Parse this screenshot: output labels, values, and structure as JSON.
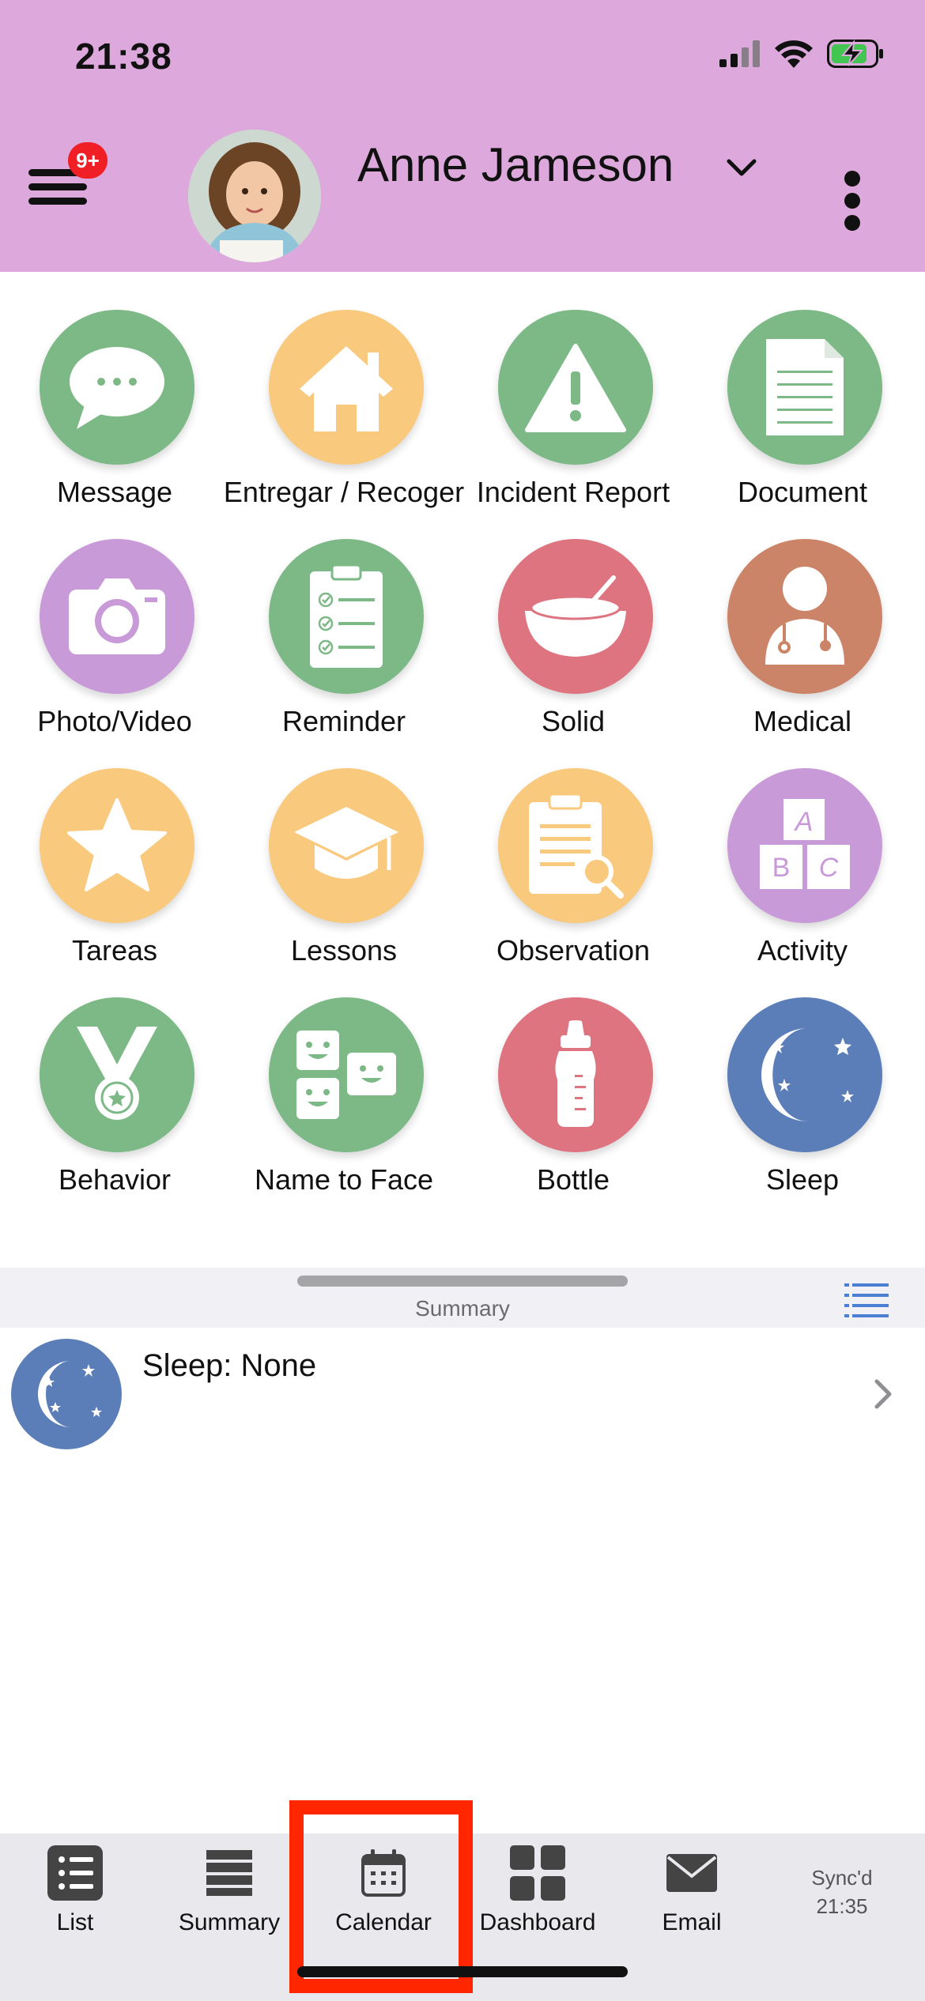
{
  "status_bar": {
    "time": "21:38"
  },
  "header": {
    "notification_badge": "9+",
    "child_name": "Anne Jameson",
    "background": "#dda9dc"
  },
  "actions": [
    {
      "label": "Message",
      "icon": "speech-bubble-icon",
      "color": "#7cb987"
    },
    {
      "label": "Entregar / Recoger",
      "icon": "house-icon",
      "color": "#f9c97d"
    },
    {
      "label": "Incident Report",
      "icon": "warning-icon",
      "color": "#7cb987"
    },
    {
      "label": "Document",
      "icon": "document-icon",
      "color": "#7cb987"
    },
    {
      "label": "Photo/Video",
      "icon": "camera-icon",
      "color": "#c99ad8"
    },
    {
      "label": "Reminder",
      "icon": "checklist-icon",
      "color": "#7cb987"
    },
    {
      "label": "Solid",
      "icon": "food-bowl-icon",
      "color": "#dd7480"
    },
    {
      "label": "Medical",
      "icon": "doctor-icon",
      "color": "#cc8468"
    },
    {
      "label": "Tareas",
      "icon": "star-icon",
      "color": "#f9c97d"
    },
    {
      "label": "Lessons",
      "icon": "graduation-cap-icon",
      "color": "#f9c97d"
    },
    {
      "label": "Observation",
      "icon": "clipboard-search-icon",
      "color": "#f9c97d"
    },
    {
      "label": "Activity",
      "icon": "blocks-icon",
      "color": "#c99ad8"
    },
    {
      "label": "Behavior",
      "icon": "medal-icon",
      "color": "#7cb987"
    },
    {
      "label": "Name to Face",
      "icon": "faces-icon",
      "color": "#7cb987"
    },
    {
      "label": "Bottle",
      "icon": "bottle-icon",
      "color": "#dd7480"
    },
    {
      "label": "Sleep",
      "icon": "moon-stars-icon",
      "color": "#5b7eb9"
    }
  ],
  "summary_sheet": {
    "title": "Summary",
    "rows": [
      {
        "text": "Sleep: None",
        "icon": "moon-stars-icon"
      }
    ]
  },
  "tabbar": {
    "tabs": [
      {
        "label": "List",
        "icon": "list-icon"
      },
      {
        "label": "Summary",
        "icon": "summary-icon"
      },
      {
        "label": "Calendar",
        "icon": "calendar-icon"
      },
      {
        "label": "Dashboard",
        "icon": "dashboard-icon"
      },
      {
        "label": "Email",
        "icon": "email-icon"
      }
    ],
    "sync_line1": "Sync'd",
    "sync_line2": "21:35",
    "highlighted_tab": "Calendar",
    "highlight_color": "#ff2600"
  }
}
